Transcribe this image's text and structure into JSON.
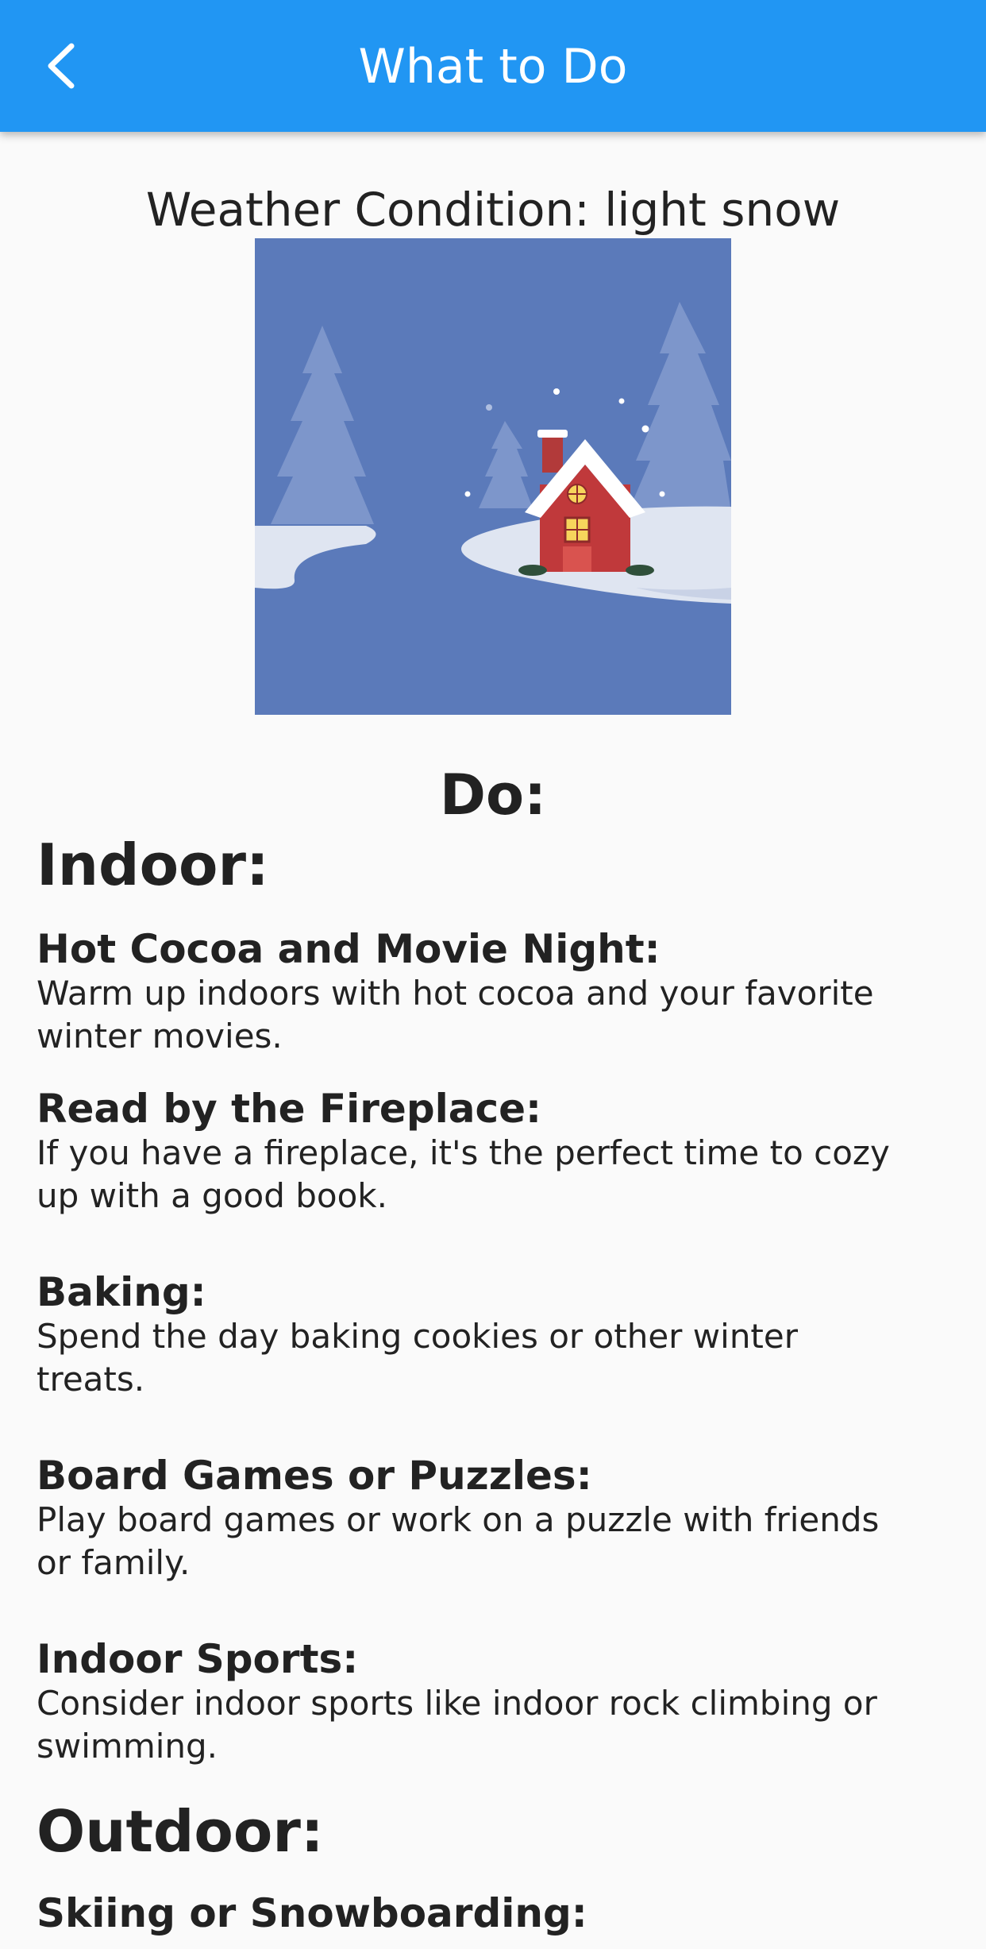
{
  "app_bar": {
    "title": "What to Do",
    "background": "#2196f3",
    "back_icon": "chevron-left-icon"
  },
  "weather": {
    "condition_text": "Weather Condition: light snow",
    "image": "snowy-cabin-illustration"
  },
  "do_heading": "Do:",
  "indoor": {
    "heading": "Indoor:",
    "activities": [
      {
        "title": "Hot Cocoa and Movie Night:",
        "description": "Warm up indoors with hot cocoa and your favorite winter movies."
      },
      {
        "title": "Read by the Fireplace:",
        "description": "If you have a fireplace, it's the perfect time to cozy up with a good book."
      },
      {
        "title": "Baking:",
        "description": "Spend the day baking cookies or other winter treats."
      },
      {
        "title": "Board Games or Puzzles:",
        "description": "Play board games or work on a puzzle with friends or family."
      },
      {
        "title": "Indoor Sports:",
        "description": "Consider indoor sports like indoor rock climbing or swimming."
      }
    ]
  },
  "outdoor": {
    "heading": "Outdoor:",
    "activities": [
      {
        "title": "Skiing or Snowboarding:"
      }
    ]
  }
}
